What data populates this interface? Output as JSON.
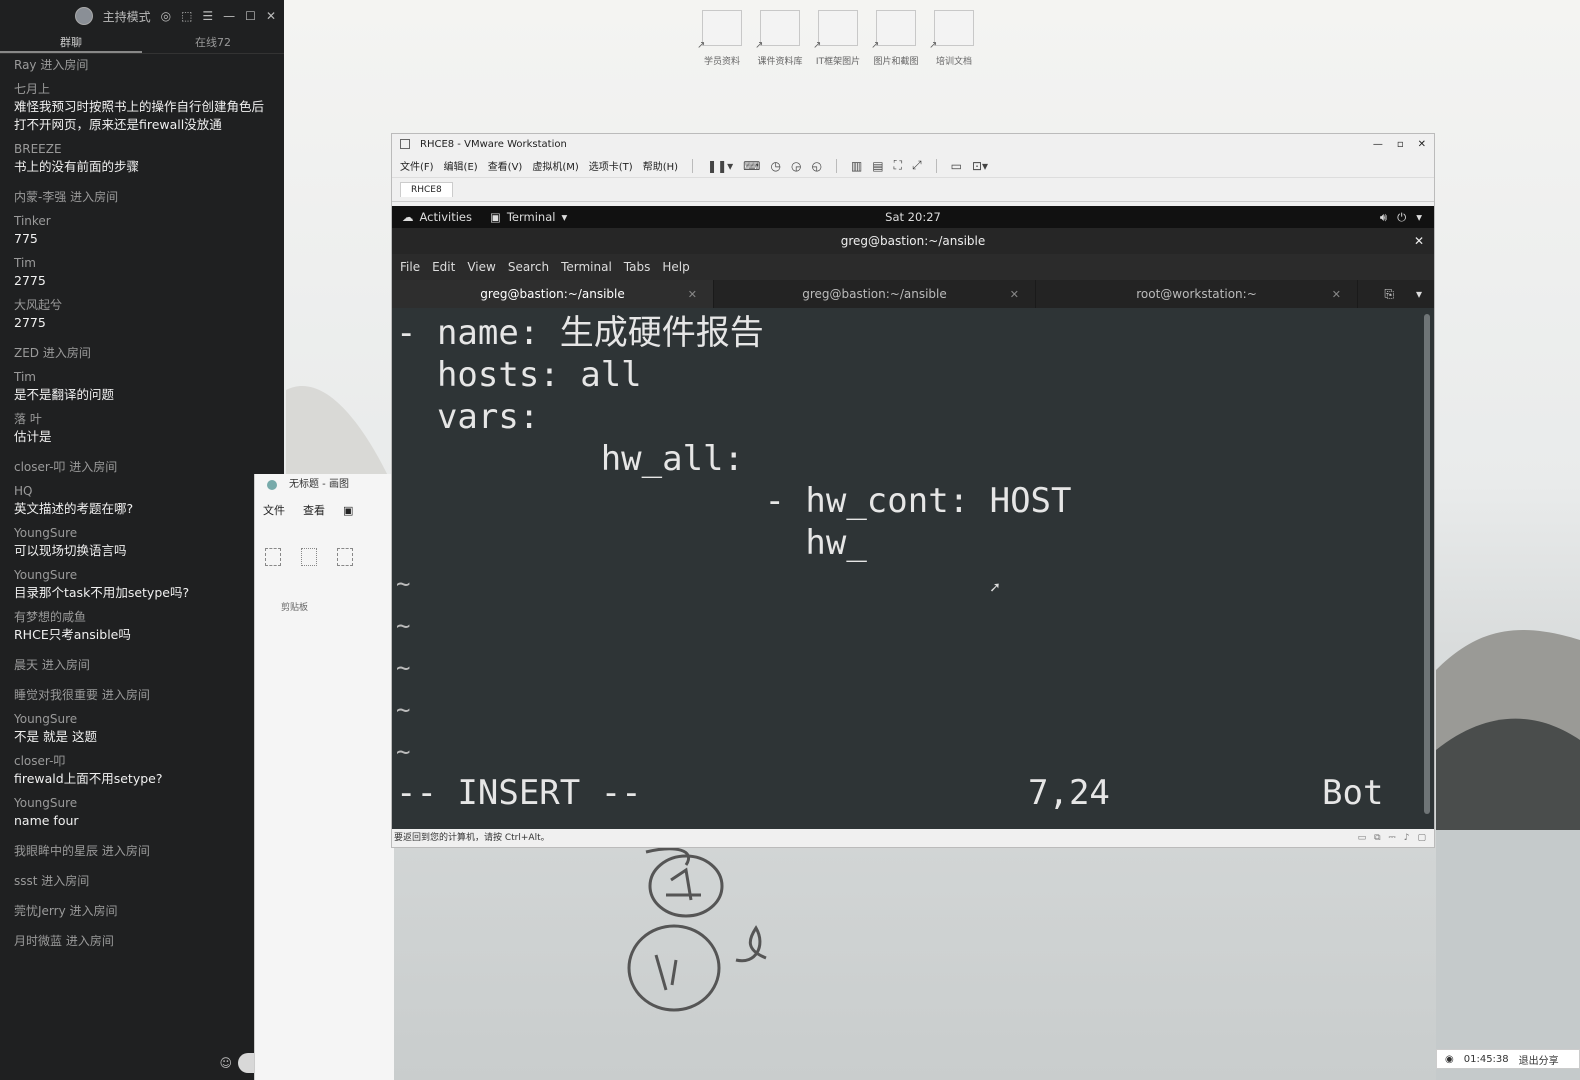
{
  "chat": {
    "mode_label": "主持模式",
    "tab_chat": "群聊",
    "tab_online": "在线72",
    "items": [
      {
        "kind": "join",
        "text": "Ray 进入房间"
      },
      {
        "kind": "msg",
        "user": "七月上",
        "text": "难怪我预习时按照书上的操作自行创建角色后打不开网页，原来还是firewall没放通"
      },
      {
        "kind": "msg",
        "user": "BREEZE",
        "text": "书上的没有前面的步骤"
      },
      {
        "kind": "join",
        "text": "内蒙-李强 进入房间"
      },
      {
        "kind": "msg",
        "user": "Tinker",
        "text": "775"
      },
      {
        "kind": "msg",
        "user": "Tim",
        "text": "2775"
      },
      {
        "kind": "msg",
        "user": "大风起兮",
        "text": "2775"
      },
      {
        "kind": "join",
        "text": "ZED 进入房间"
      },
      {
        "kind": "msg",
        "user": "Tim",
        "text": "是不是翻译的问题"
      },
      {
        "kind": "msg",
        "user": "落    叶",
        "text": "估计是"
      },
      {
        "kind": "join",
        "text": "closer-叩    进入房间"
      },
      {
        "kind": "msg",
        "user": "HQ",
        "text": "英文描述的考题在哪?"
      },
      {
        "kind": "msg",
        "user": "YoungSure",
        "text": "可以现场切换语言吗"
      },
      {
        "kind": "msg",
        "user": "YoungSure",
        "text": "目录那个task不用加setype吗?"
      },
      {
        "kind": "msg",
        "user": "有梦想的咸鱼",
        "text": "RHCE只考ansible吗"
      },
      {
        "kind": "join",
        "text": "晨天 进入房间"
      },
      {
        "kind": "join",
        "text": "睡觉对我很重要 进入房间"
      },
      {
        "kind": "msg",
        "user": "YoungSure",
        "text": "不是  就是 这题"
      },
      {
        "kind": "msg",
        "user": "closer-叩",
        "text": "firewald上面不用setype?"
      },
      {
        "kind": "msg",
        "user": "YoungSure",
        "text": "name four"
      },
      {
        "kind": "join",
        "text": "我眼眸中的星辰 进入房间"
      },
      {
        "kind": "join",
        "text": "ssst 进入房间"
      },
      {
        "kind": "join",
        "text": "莞忧Jerry 进入房间"
      },
      {
        "kind": "join",
        "text": "月时微蓝 进入房间"
      }
    ]
  },
  "desktop": {
    "icons": [
      "学员资料",
      "课件资料库",
      "IT框架图片",
      "图片和截图",
      "培训文档"
    ]
  },
  "paint": {
    "title": "无标题 - 画图",
    "menu_file": "文件",
    "menu_view": "查看",
    "group_label": "剪贴板"
  },
  "vmware": {
    "title": "RHCE8 - VMware Workstation",
    "menu": [
      "文件(F)",
      "编辑(E)",
      "查看(V)",
      "虚拟机(M)",
      "选项卡(T)",
      "帮助(H)"
    ],
    "vm_tab": "RHCE8",
    "status": "要返回到您的计算机，请按 Ctrl+Alt。"
  },
  "gnome": {
    "activities": "Activities",
    "app": "Terminal",
    "clock": "Sat 20:27"
  },
  "terminal": {
    "title": "greg@bastion:~/ansible",
    "menu": [
      "File",
      "Edit",
      "View",
      "Search",
      "Terminal",
      "Tabs",
      "Help"
    ],
    "tabs": [
      "greg@bastion:~/ansible",
      "greg@bastion:~/ansible",
      "root@workstation:~"
    ],
    "lines": [
      "- name: 生成硬件报告",
      "  hosts: all",
      "  vars:",
      "          hw_all:",
      "                  - hw_cont: HOST",
      "                    hw_"
    ],
    "mode": "-- INSERT --",
    "position": "7,24",
    "scroll": "Bot"
  },
  "taskbar": {
    "time": "01:45:38",
    "share_label": "退出分享"
  }
}
